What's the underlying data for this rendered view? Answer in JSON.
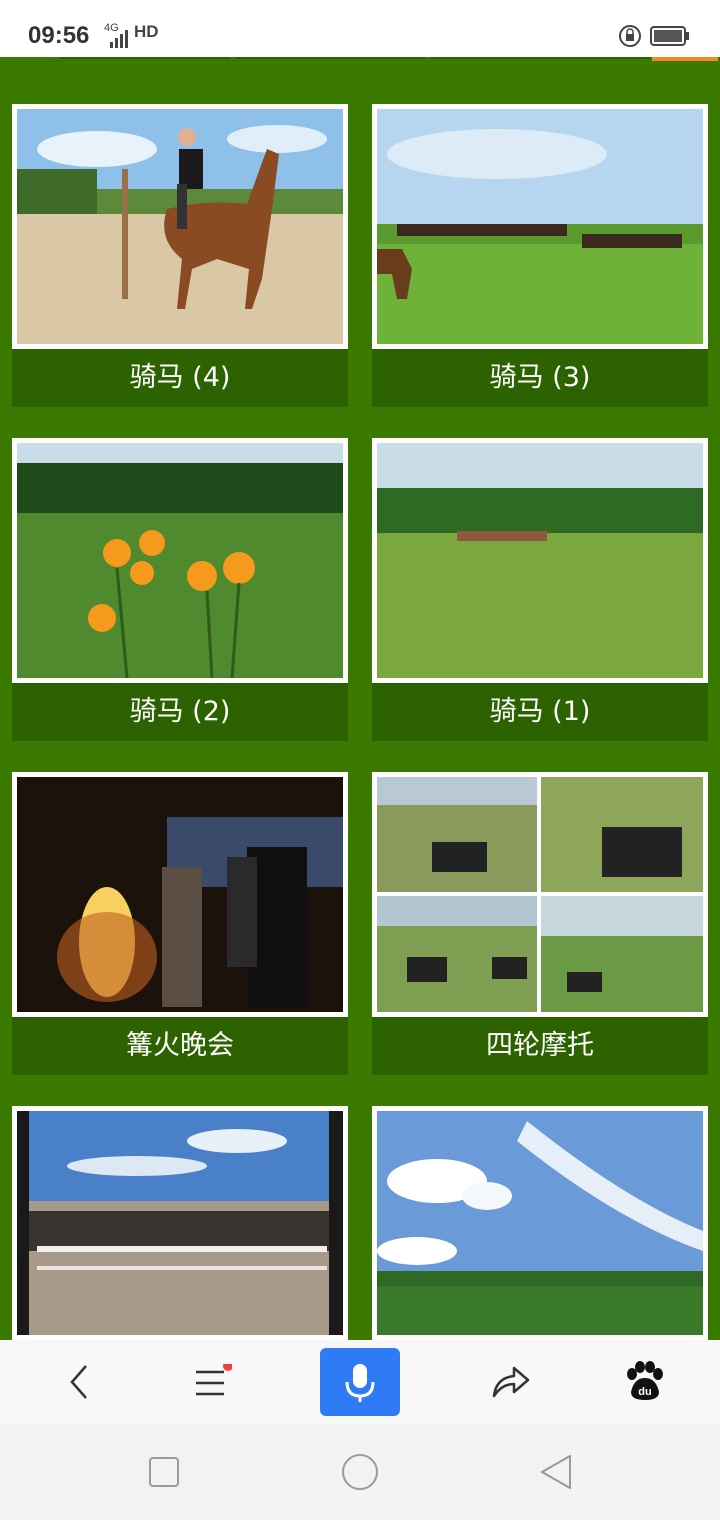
{
  "status_bar": {
    "time": "09:56",
    "network": "4G",
    "hd": "HD",
    "lock_icon": "rotation-lock-icon",
    "battery_icon": "battery-icon"
  },
  "gallery": {
    "items": [
      {
        "caption": "骑马 (4)",
        "image": "man-riding-horse-photo"
      },
      {
        "caption": "骑马 (3)",
        "image": "riders-on-grassland-photo"
      },
      {
        "caption": "骑马 (2)",
        "image": "orange-flowers-meadow-photo"
      },
      {
        "caption": "骑马 (1)",
        "image": "horses-grazing-field-photo"
      },
      {
        "caption": "篝火晚会",
        "image": "bonfire-night-party-photo"
      },
      {
        "caption": "四轮摩托",
        "image": "atv-riding-collage-photo"
      },
      {
        "caption": "",
        "image": "horse-corral-photo"
      },
      {
        "caption": "",
        "image": "sky-and-forest-photo"
      }
    ]
  },
  "bottom_bar": {
    "back": "back-icon",
    "menu": "menu-icon",
    "voice": "microphone-icon",
    "share": "share-icon",
    "baidu": "baidu-paw-icon"
  },
  "system_nav": {
    "recent": "recent-apps-icon",
    "home": "home-icon",
    "back": "back-triangle-icon"
  },
  "colors": {
    "page_green": "#3a7a00",
    "caption_green": "#2c6200",
    "accent_orange": "#f08a24",
    "voice_blue": "#2f7bf5"
  }
}
